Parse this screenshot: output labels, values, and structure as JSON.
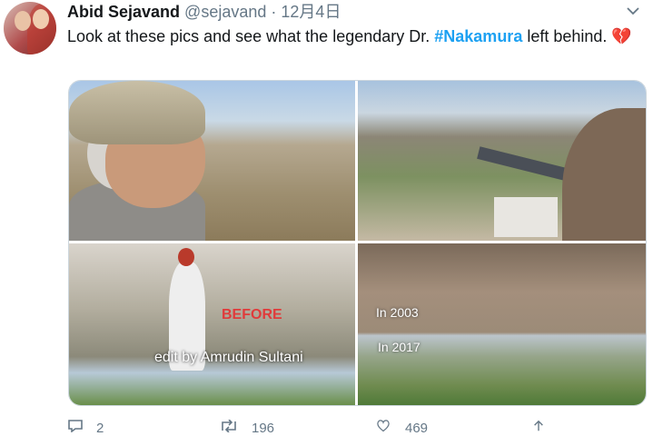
{
  "tweet": {
    "author_name": "Abid Sejavand",
    "author_handle": "@sejavand",
    "separator": "·",
    "date": "12月4日",
    "text_before": "Look at these pics and see what the legendary Dr. ",
    "hashtag": "#Nakamura",
    "text_after": " left behind. ",
    "emoji": "💔"
  },
  "media": {
    "captions": {
      "before": "BEFORE",
      "edit": "edit by Amrudin Sultani",
      "year_2003": "In 2003",
      "year_2017": "In 2017"
    }
  },
  "actions": {
    "reply_count": "2",
    "retweet_count": "196",
    "like_count": "469"
  },
  "icons": {
    "caret": "chevron-down-icon",
    "reply": "reply-icon",
    "retweet": "retweet-icon",
    "like": "heart-icon",
    "share": "share-icon"
  },
  "colors": {
    "link": "#1da1f2",
    "muted": "#657786",
    "text": "#14171a"
  }
}
